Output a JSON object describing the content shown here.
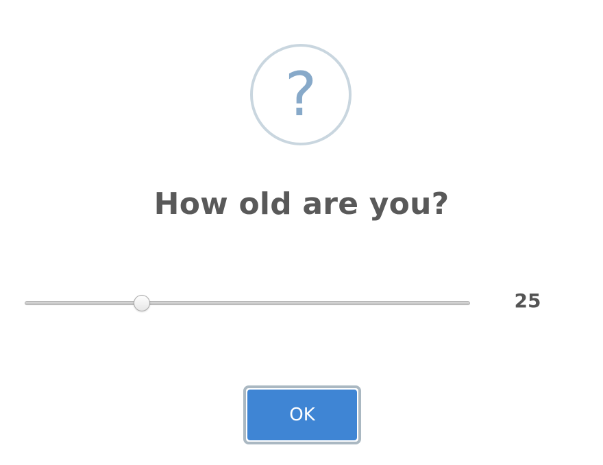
{
  "dialog": {
    "icon": {
      "name": "question-icon",
      "glyph": "?"
    },
    "title": "How old are you?",
    "slider": {
      "min": 0,
      "max": 100,
      "value": 25,
      "display": "25"
    },
    "ok_label": "OK"
  },
  "colors": {
    "icon_border": "#c9d6df",
    "icon_glyph": "#87a9c9",
    "title_text": "#595959",
    "button_bg": "#3f85d4",
    "button_text": "#ffffff"
  }
}
